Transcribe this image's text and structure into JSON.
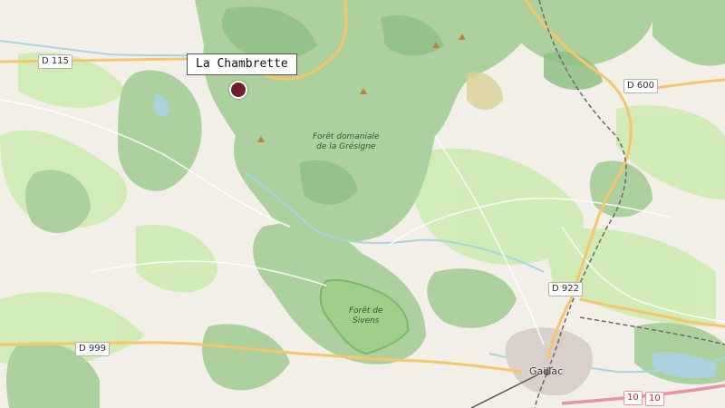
{
  "map": {
    "marker": {
      "label": "La Chambrette",
      "color": "#6e2031"
    },
    "roads": [
      {
        "ref": "D 115"
      },
      {
        "ref": "D 600"
      },
      {
        "ref": "D 922"
      },
      {
        "ref": "D 999"
      },
      {
        "ref": "10"
      },
      {
        "ref": "10"
      }
    ],
    "areas": [
      {
        "line1": "Forêt domaniale",
        "line2": "de la Grésigne"
      },
      {
        "line1": "Forêt de",
        "line2": "Sivens"
      }
    ],
    "towns": [
      {
        "name": "Gaillac"
      }
    ],
    "colors": {
      "background": "#f2efe9",
      "forest": "#add19e",
      "forest_dark": "#8fbf85",
      "meadow": "#cdebb0",
      "road_primary": "#f7c66c",
      "water": "#aad3df",
      "urban": "#d9d0c9",
      "railway": "#6a6a6a",
      "motorway": "#e892a2"
    }
  }
}
